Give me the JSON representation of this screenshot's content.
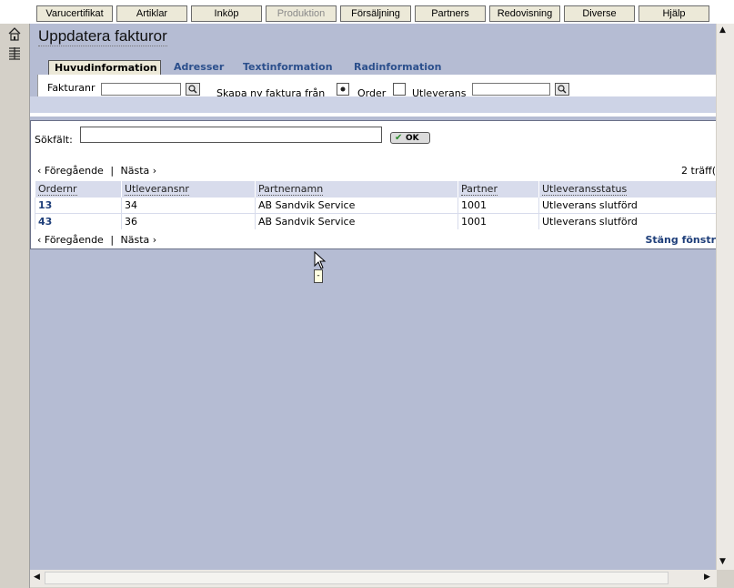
{
  "top_menu": [
    {
      "label": "Varucertifikat",
      "disabled": false
    },
    {
      "label": "Artiklar",
      "disabled": false
    },
    {
      "label": "Inköp",
      "disabled": false
    },
    {
      "label": "Produktion",
      "disabled": true
    },
    {
      "label": "Försäljning",
      "disabled": false
    },
    {
      "label": "Partners",
      "disabled": false
    },
    {
      "label": "Redovisning",
      "disabled": false
    },
    {
      "label": "Diverse",
      "disabled": false
    },
    {
      "label": "Hjälp",
      "disabled": false
    }
  ],
  "left_icons": [
    "home-icon",
    "list-icon"
  ],
  "page_title": "Uppdatera fakturor",
  "tabs": [
    "Huvudinformation",
    "Adresser",
    "Textinformation",
    "Radinformation"
  ],
  "form": {
    "fakturanr_label": "Fakturanr",
    "skapa_label": "Skapa ny faktura från",
    "order_label": "Order",
    "utleverans_label": "Utleverans"
  },
  "search": {
    "label": "Sökfält:",
    "value": "",
    "ok_label": "OK"
  },
  "pager": {
    "prev": "‹ Föregående",
    "sep": "|",
    "next": "Nästa ›"
  },
  "hits": "2 träff(",
  "table": {
    "headers": [
      "Ordernr",
      "Utleveransnr",
      "Partnernamn",
      "Partner",
      "Utleveransstatus"
    ],
    "rows": [
      [
        "13",
        "34",
        "AB Sandvik Service",
        "1001",
        "Utleverans slutförd"
      ],
      [
        "43",
        "36",
        "AB Sandvik Service",
        "1001",
        "Utleverans slutförd"
      ]
    ]
  },
  "close_link": "Stäng fönstr",
  "tooltip": "-",
  "colors": {
    "background": "#b5bcd3",
    "link": "#1f3f7a",
    "header_row": "#d8dcec"
  }
}
